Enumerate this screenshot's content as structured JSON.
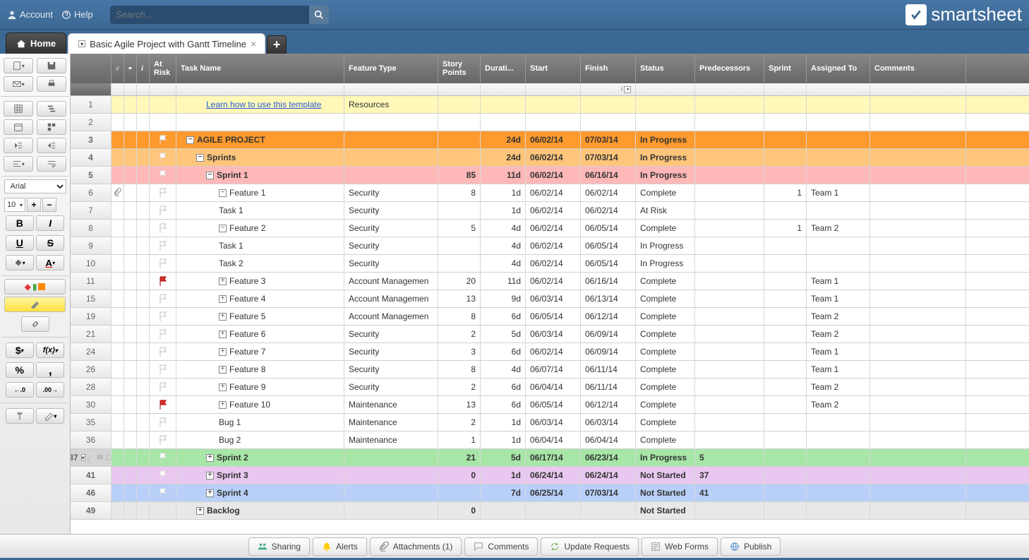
{
  "header": {
    "account": "Account",
    "help": "Help",
    "search_placeholder": "Search...",
    "logo": "smartsheet"
  },
  "tabs": {
    "home": "Home",
    "sheet": "Basic Agile Project with Gantt Timeline"
  },
  "toolbar": {
    "font": "Arial",
    "size": "10",
    "bold": "B",
    "italic": "I",
    "underline": "U",
    "strike": "S",
    "currency": "$",
    "fx": "f(x)",
    "percent": "%",
    "comma": ",",
    "dec_dec": ".0",
    "inc_dec": ".00"
  },
  "columns": {
    "risk": "At Risk",
    "task": "Task Name",
    "feature": "Feature Type",
    "story": "Story Points",
    "duration": "Durati...",
    "start": "Start",
    "finish": "Finish",
    "status": "Status",
    "pred": "Predecessors",
    "sprint": "Sprint",
    "assigned": "Assigned To",
    "comments": "Comments",
    "info": "i"
  },
  "rows": [
    {
      "num": "1",
      "bg": "yellow",
      "task": "Learn how to use this template",
      "link": true,
      "feat": "Resources",
      "indent": 3
    },
    {
      "num": "2",
      "bg": "",
      "task": ""
    },
    {
      "num": "3",
      "bg": "orange",
      "flag": "white",
      "task": "AGILE PROJECT",
      "exp": "-",
      "indent": 1,
      "dur": "24d",
      "start": "06/02/14",
      "finish": "07/03/14",
      "status": "In Progress"
    },
    {
      "num": "4",
      "bg": "lightorange",
      "flag": "white",
      "task": "Sprints",
      "exp": "-",
      "indent": 2,
      "dur": "24d",
      "start": "06/02/14",
      "finish": "07/03/14",
      "status": "In Progress"
    },
    {
      "num": "5",
      "bg": "pink",
      "flag": "white",
      "task": "Sprint 1",
      "exp": "-",
      "indent": 3,
      "story": "85",
      "dur": "11d",
      "start": "06/02/14",
      "finish": "06/16/14",
      "status": "In Progress"
    },
    {
      "num": "6",
      "attach": true,
      "flag": "outline",
      "task": "Feature 1",
      "exp": "-",
      "indent": 4,
      "feat": "Security",
      "story": "8",
      "dur": "1d",
      "start": "06/02/14",
      "finish": "06/02/14",
      "status": "Complete",
      "sprint": "1",
      "assigned": "Team 1"
    },
    {
      "num": "7",
      "flag": "outline",
      "task": "Task 1",
      "indent": 5,
      "feat": "Security",
      "dur": "1d",
      "start": "06/02/14",
      "finish": "06/02/14",
      "status": "At Risk"
    },
    {
      "num": "8",
      "flag": "outline",
      "task": "Feature 2",
      "exp": "-",
      "indent": 4,
      "feat": "Security",
      "story": "5",
      "dur": "4d",
      "start": "06/02/14",
      "finish": "06/05/14",
      "status": "Complete",
      "sprint": "1",
      "assigned": "Team 2"
    },
    {
      "num": "9",
      "flag": "outline",
      "task": "Task 1",
      "indent": 5,
      "feat": "Security",
      "dur": "4d",
      "start": "06/02/14",
      "finish": "06/05/14",
      "status": "In Progress"
    },
    {
      "num": "10",
      "flag": "outline",
      "task": "Task 2",
      "indent": 5,
      "feat": "Security",
      "dur": "4d",
      "start": "06/02/14",
      "finish": "06/05/14",
      "status": "In Progress"
    },
    {
      "num": "11",
      "flag": "red",
      "task": "Feature 3",
      "exp": "+",
      "indent": 4,
      "feat": "Account Managemen",
      "story": "20",
      "dur": "11d",
      "start": "06/02/14",
      "finish": "06/16/14",
      "status": "Complete",
      "assigned": "Team 1"
    },
    {
      "num": "15",
      "flag": "outline",
      "task": "Feature 4",
      "exp": "+",
      "indent": 4,
      "feat": "Account Managemen",
      "story": "13",
      "dur": "9d",
      "start": "06/03/14",
      "finish": "06/13/14",
      "status": "Complete",
      "assigned": "Team 1"
    },
    {
      "num": "19",
      "flag": "outline",
      "task": "Feature 5",
      "exp": "+",
      "indent": 4,
      "feat": "Account Managemen",
      "story": "8",
      "dur": "6d",
      "start": "06/05/14",
      "finish": "06/12/14",
      "status": "Complete",
      "assigned": "Team 2"
    },
    {
      "num": "21",
      "flag": "outline",
      "task": "Feature 6",
      "exp": "+",
      "indent": 4,
      "feat": "Security",
      "story": "2",
      "dur": "5d",
      "start": "06/03/14",
      "finish": "06/09/14",
      "status": "Complete",
      "assigned": "Team 2"
    },
    {
      "num": "24",
      "flag": "outline",
      "task": "Feature 7",
      "exp": "+",
      "indent": 4,
      "feat": "Security",
      "story": "3",
      "dur": "6d",
      "start": "06/02/14",
      "finish": "06/09/14",
      "status": "Complete",
      "assigned": "Team 1"
    },
    {
      "num": "26",
      "flag": "outline",
      "task": "Feature 8",
      "exp": "+",
      "indent": 4,
      "feat": "Security",
      "story": "8",
      "dur": "4d",
      "start": "06/07/14",
      "finish": "06/11/14",
      "status": "Complete",
      "assigned": "Team 1"
    },
    {
      "num": "28",
      "flag": "outline",
      "task": "Feature 9",
      "exp": "+",
      "indent": 4,
      "feat": "Security",
      "story": "2",
      "dur": "6d",
      "start": "06/04/14",
      "finish": "06/11/14",
      "status": "Complete",
      "assigned": "Team 2"
    },
    {
      "num": "30",
      "flag": "red",
      "task": "Feature 10",
      "exp": "+",
      "indent": 4,
      "feat": "Maintenance",
      "story": "13",
      "dur": "6d",
      "start": "06/05/14",
      "finish": "06/12/14",
      "status": "Complete",
      "assigned": "Team 2"
    },
    {
      "num": "35",
      "flag": "outline",
      "task": "Bug 1",
      "indent": 5,
      "feat": "Maintenance",
      "story": "2",
      "dur": "1d",
      "start": "06/03/14",
      "finish": "06/03/14",
      "status": "Complete"
    },
    {
      "num": "36",
      "flag": "outline",
      "task": "Bug 2",
      "indent": 5,
      "feat": "Maintenance",
      "story": "1",
      "dur": "1d",
      "start": "06/04/14",
      "finish": "06/04/14",
      "status": "Complete"
    },
    {
      "num": "37",
      "bg": "green",
      "sel": true,
      "flag": "white",
      "task": "Sprint 2",
      "exp": "+",
      "indent": 3,
      "story": "21",
      "dur": "5d",
      "start": "06/17/14",
      "finish": "06/23/14",
      "status": "In Progress",
      "pred": "5"
    },
    {
      "num": "41",
      "bg": "lavender",
      "flag": "white",
      "task": "Sprint 3",
      "exp": "+",
      "indent": 3,
      "story": "0",
      "dur": "1d",
      "start": "06/24/14",
      "finish": "06/24/14",
      "status": "Not Started",
      "pred": "37"
    },
    {
      "num": "46",
      "bg": "blue",
      "flag": "white",
      "task": "Sprint 4",
      "exp": "+",
      "indent": 3,
      "story": "",
      "dur": "7d",
      "start": "06/25/14",
      "finish": "07/03/14",
      "status": "Not Started",
      "pred": "41"
    },
    {
      "num": "49",
      "bg": "gray",
      "task": "Backlog",
      "exp": "+",
      "indent": 2,
      "story": "0",
      "status": "Not Started"
    }
  ],
  "footer": {
    "sharing": "Sharing",
    "alerts": "Alerts",
    "attachments": "Attachments (1)",
    "comments": "Comments",
    "updates": "Update Requests",
    "forms": "Web Forms",
    "publish": "Publish"
  }
}
